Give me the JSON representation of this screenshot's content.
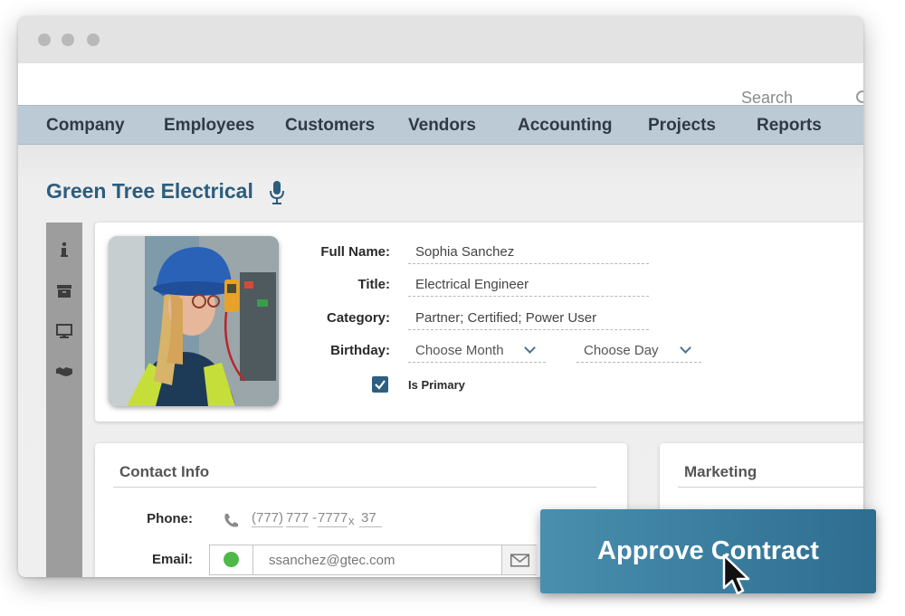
{
  "window": {
    "controls": [
      "close",
      "minimize",
      "maximize"
    ]
  },
  "search": {
    "placeholder": "Search",
    "icon": "search-icon"
  },
  "nav": {
    "items": [
      {
        "label": "Company"
      },
      {
        "label": "Employees"
      },
      {
        "label": "Customers"
      },
      {
        "label": "Vendors"
      },
      {
        "label": "Accounting"
      },
      {
        "label": "Projects"
      },
      {
        "label": "Reports"
      }
    ]
  },
  "page": {
    "title": "Green Tree Electrical",
    "title_icon": "microphone-icon"
  },
  "side_rail": {
    "icons": [
      "info-icon",
      "archive-icon",
      "monitor-icon",
      "handshake-icon"
    ]
  },
  "profile": {
    "photo": "photo of woman wearing blue hard hat and safety vest",
    "full_name_label": "Full Name:",
    "full_name": "Sophia Sanchez",
    "title_label": "Title:",
    "title": "Electrical Engineer",
    "category_label": "Category:",
    "category": "Partner; Certified; Power User",
    "birthday_label": "Birthday:",
    "birthday_month": "Choose Month",
    "birthday_day": "Choose Day",
    "is_primary_label": "Is Primary",
    "is_primary": true
  },
  "contact": {
    "heading": "Contact Info",
    "phone_label": "Phone:",
    "phone_area": "(777)",
    "phone_prefix": "777",
    "phone_line": "7777",
    "phone_ext_sep": "x",
    "phone_ext": "37",
    "email_label": "Email:",
    "email": "ssanchez@gtec.com",
    "email_status_color": "#4fb84a"
  },
  "marketing": {
    "heading": "Marketing"
  },
  "cta": {
    "label": "Approve Contract"
  },
  "colors": {
    "accent": "#2c5d7e",
    "nav_bg": "#bccad6",
    "cta_bg": "#3b7ea0"
  }
}
